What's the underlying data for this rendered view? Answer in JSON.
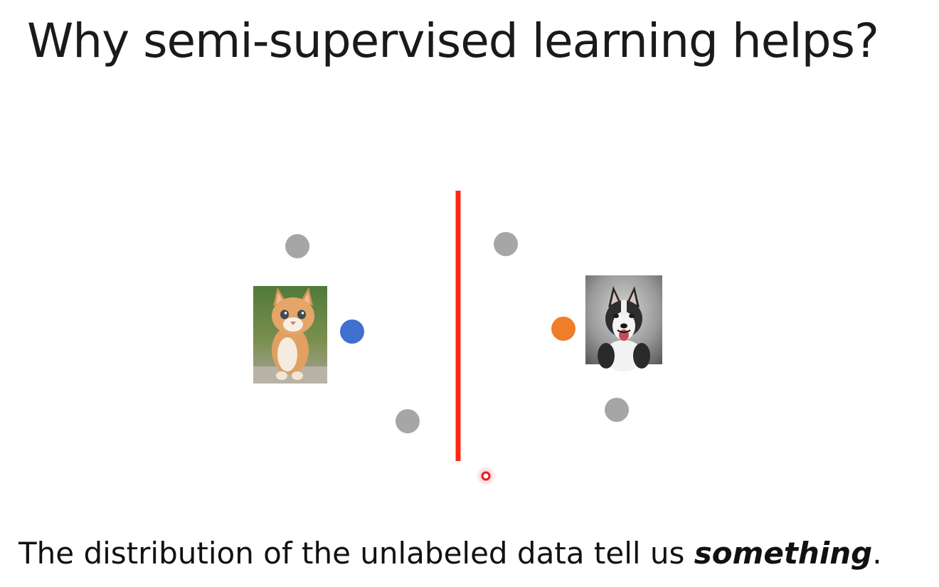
{
  "slide": {
    "title": "Why semi-supervised learning helps?",
    "caption_before": "The distribution of the unlabeled data tell us ",
    "caption_emphasis": "something",
    "caption_after": "."
  },
  "diagram": {
    "points": [
      {
        "kind": "unlabeled",
        "color": "#a6a6a6"
      },
      {
        "kind": "unlabeled",
        "color": "#a6a6a6"
      },
      {
        "kind": "unlabeled",
        "color": "#a6a6a6"
      },
      {
        "kind": "unlabeled",
        "color": "#a6a6a6"
      },
      {
        "kind": "labeled-cat",
        "color": "#3f6fcf"
      },
      {
        "kind": "labeled-dog",
        "color": "#f07d2a"
      }
    ],
    "boundary_color": "#ff2a12",
    "pointer_color": "#e02020",
    "images": [
      {
        "icon": "cat-photo"
      },
      {
        "icon": "husky-dog-photo"
      }
    ]
  }
}
